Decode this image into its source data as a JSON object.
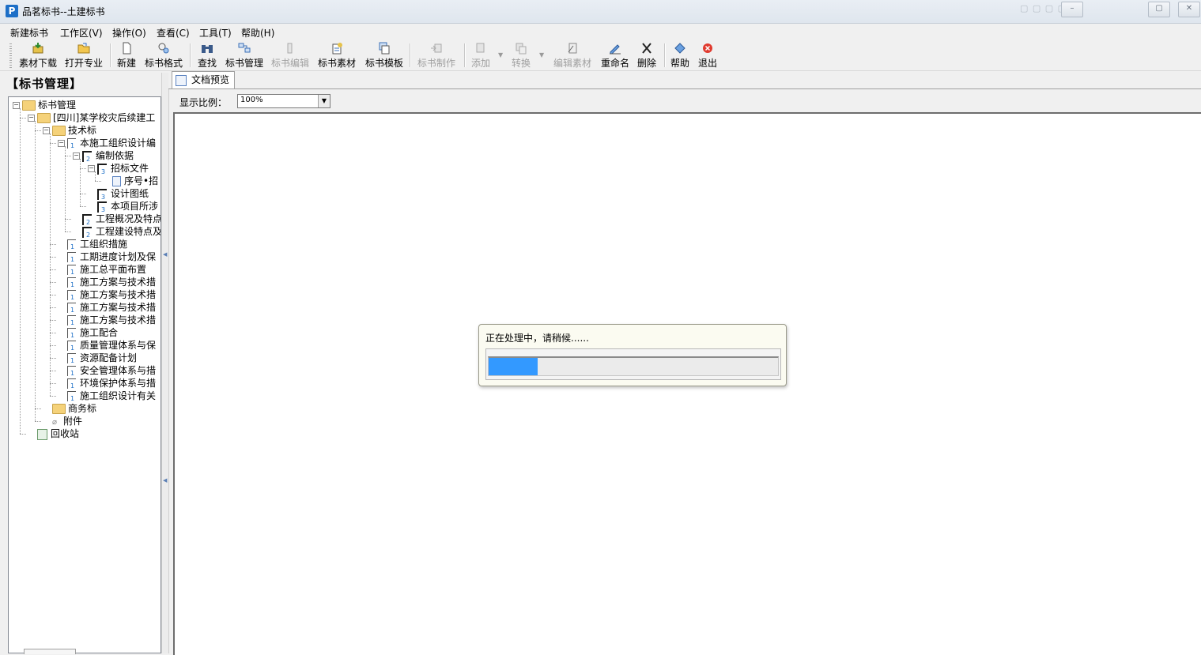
{
  "window": {
    "title": "品茗标书--土建标书",
    "app_icon_glyph": "P",
    "title_blur": "▢ ▢ ▢ ▢",
    "controls": [
      "–",
      "▢",
      "✕"
    ]
  },
  "menu": [
    "新建标书",
    "工作区(V)",
    "操作(O)",
    "查看(C)",
    "工具(T)",
    "帮助(H)"
  ],
  "toolbar": {
    "groups": [
      [
        {
          "label": "素材下载",
          "icon": "download-icon",
          "enabled": true
        },
        {
          "label": "打开专业",
          "icon": "open-folder-icon",
          "enabled": true
        }
      ],
      [
        {
          "label": "新建",
          "icon": "new-doc-icon",
          "enabled": true
        },
        {
          "label": "标书格式",
          "icon": "format-icon",
          "enabled": true
        }
      ],
      [
        {
          "label": "查找",
          "icon": "binoculars-icon",
          "enabled": true
        },
        {
          "label": "标书管理",
          "icon": "manage-icon",
          "enabled": true
        },
        {
          "label": "标书编辑",
          "icon": "edit-icon",
          "enabled": false
        },
        {
          "label": "标书素材",
          "icon": "material-icon",
          "enabled": true
        },
        {
          "label": "标书模板",
          "icon": "template-icon",
          "enabled": true
        }
      ],
      [
        {
          "label": "标书制作",
          "icon": "build-icon",
          "enabled": false
        }
      ],
      [
        {
          "label": "添加",
          "icon": "add-icon",
          "enabled": false
        },
        {
          "label": "转换",
          "icon": "convert-icon",
          "enabled": false
        },
        {
          "label": "编辑素材",
          "icon": "edit-material-icon",
          "enabled": false
        },
        {
          "label": "重命名",
          "icon": "rename-icon",
          "enabled": true
        },
        {
          "label": "删除",
          "icon": "delete-icon",
          "enabled": true
        }
      ],
      [
        {
          "label": "帮助",
          "icon": "help-icon",
          "enabled": true
        },
        {
          "label": "退出",
          "icon": "exit-icon",
          "enabled": true
        }
      ]
    ]
  },
  "left_panel": {
    "title": "【标书管理】",
    "tree": [
      {
        "label": "标书管理",
        "depth": 0,
        "icon": "folder",
        "exp": "−"
      },
      {
        "label": "[四川]某学校灾后续建工",
        "depth": 1,
        "icon": "folder",
        "exp": "−"
      },
      {
        "label": "技术标",
        "depth": 2,
        "icon": "folder",
        "exp": "−"
      },
      {
        "label": "本施工组织设计编",
        "depth": 3,
        "icon": "doc",
        "level": "1",
        "exp": "−"
      },
      {
        "label": "编制依据",
        "depth": 4,
        "icon": "doc",
        "level": "2",
        "exp": "−"
      },
      {
        "label": "招标文件",
        "depth": 5,
        "icon": "doc",
        "level": "3",
        "exp": "−"
      },
      {
        "label": "序号•招",
        "depth": 6,
        "icon": "sheet"
      },
      {
        "label": "设计图纸",
        "depth": 5,
        "icon": "doc",
        "level": "3"
      },
      {
        "label": "本项目所涉",
        "depth": 5,
        "icon": "doc",
        "level": "3"
      },
      {
        "label": "工程概况及特点",
        "depth": 4,
        "icon": "doc",
        "level": "2"
      },
      {
        "label": "工程建设特点及",
        "depth": 4,
        "icon": "doc",
        "level": "2"
      },
      {
        "label": "工组织措施",
        "depth": 3,
        "icon": "doc",
        "level": "1"
      },
      {
        "label": "工期进度计划及保",
        "depth": 3,
        "icon": "doc",
        "level": "1"
      },
      {
        "label": "施工总平面布置",
        "depth": 3,
        "icon": "doc",
        "level": "1"
      },
      {
        "label": "施工方案与技术措",
        "depth": 3,
        "icon": "doc",
        "level": "1"
      },
      {
        "label": "施工方案与技术措",
        "depth": 3,
        "icon": "doc",
        "level": "1"
      },
      {
        "label": "施工方案与技术措",
        "depth": 3,
        "icon": "doc",
        "level": "1"
      },
      {
        "label": "施工方案与技术措",
        "depth": 3,
        "icon": "doc",
        "level": "1"
      },
      {
        "label": "施工配合",
        "depth": 3,
        "icon": "doc",
        "level": "1"
      },
      {
        "label": "质量管理体系与保",
        "depth": 3,
        "icon": "doc",
        "level": "1"
      },
      {
        "label": "资源配备计划",
        "depth": 3,
        "icon": "doc",
        "level": "1"
      },
      {
        "label": "安全管理体系与措",
        "depth": 3,
        "icon": "doc",
        "level": "1"
      },
      {
        "label": "环境保护体系与措",
        "depth": 3,
        "icon": "doc",
        "level": "1"
      },
      {
        "label": "施工组织设计有关",
        "depth": 3,
        "icon": "doc",
        "level": "1"
      },
      {
        "label": "商务标",
        "depth": 2,
        "icon": "folder"
      },
      {
        "label": "附件",
        "depth": 2,
        "icon": "clip"
      },
      {
        "label": "回收站",
        "depth": 1,
        "icon": "bin"
      }
    ]
  },
  "preview": {
    "tab_label": "文档预览",
    "zoom_label": "显示比例：",
    "zoom_value": "100%"
  },
  "progress": {
    "message": "正在处理中，请稍候......",
    "fraction": 0.17,
    "color": "#3399ff"
  }
}
